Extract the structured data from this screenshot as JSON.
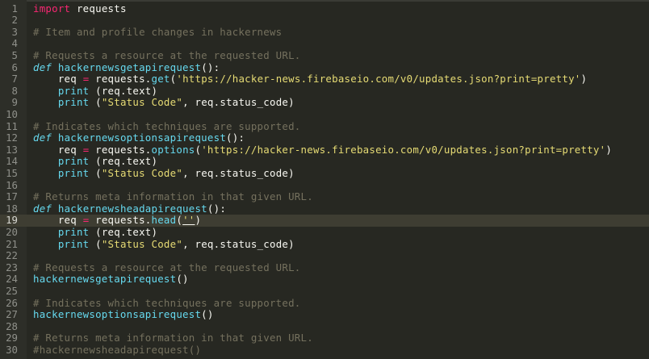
{
  "editor": {
    "colors": {
      "background": "#272822",
      "keyword": "#f92672",
      "function": "#66d9ef",
      "comment": "#75715e",
      "string": "#e6db74",
      "text": "#f8f8f2"
    },
    "current_line": 19,
    "lines": [
      {
        "n": "1",
        "tokens": [
          {
            "t": "import",
            "c": "kw"
          },
          {
            "t": " requests"
          }
        ]
      },
      {
        "n": "2",
        "tokens": []
      },
      {
        "n": "3",
        "tokens": [
          {
            "t": "# Item and profile changes in hackernews",
            "c": "cm"
          }
        ]
      },
      {
        "n": "4",
        "tokens": []
      },
      {
        "n": "5",
        "tokens": [
          {
            "t": "# Requests a resource at the requested URL.",
            "c": "cm"
          }
        ]
      },
      {
        "n": "6",
        "tokens": [
          {
            "t": "def",
            "c": "def"
          },
          {
            "t": " "
          },
          {
            "t": "hackernewsgetapirequest",
            "c": "fn"
          },
          {
            "t": "():"
          }
        ]
      },
      {
        "n": "7",
        "tokens": [
          {
            "t": "    req "
          },
          {
            "t": "=",
            "c": "op"
          },
          {
            "t": " requests."
          },
          {
            "t": "get",
            "c": "bl"
          },
          {
            "t": "("
          },
          {
            "t": "'https://hacker-news.firebaseio.com/v0/updates.json?print=pretty'",
            "c": "str"
          },
          {
            "t": ")"
          }
        ]
      },
      {
        "n": "8",
        "tokens": [
          {
            "t": "    "
          },
          {
            "t": "print",
            "c": "bl"
          },
          {
            "t": " (req.text)"
          }
        ]
      },
      {
        "n": "9",
        "tokens": [
          {
            "t": "    "
          },
          {
            "t": "print",
            "c": "bl"
          },
          {
            "t": " ("
          },
          {
            "t": "\"Status Code\"",
            "c": "str"
          },
          {
            "t": ", req.status_code)"
          }
        ]
      },
      {
        "n": "10",
        "tokens": []
      },
      {
        "n": "11",
        "tokens": [
          {
            "t": "# Indicates which techniques are supported.",
            "c": "cm"
          }
        ]
      },
      {
        "n": "12",
        "tokens": [
          {
            "t": "def",
            "c": "def"
          },
          {
            "t": " "
          },
          {
            "t": "hackernewsoptionsapirequest",
            "c": "fn"
          },
          {
            "t": "():"
          }
        ]
      },
      {
        "n": "13",
        "tokens": [
          {
            "t": "    req "
          },
          {
            "t": "=",
            "c": "op"
          },
          {
            "t": " requests."
          },
          {
            "t": "options",
            "c": "bl"
          },
          {
            "t": "("
          },
          {
            "t": "'https://hacker-news.firebaseio.com/v0/updates.json?print=pretty'",
            "c": "str"
          },
          {
            "t": ")"
          }
        ]
      },
      {
        "n": "14",
        "tokens": [
          {
            "t": "    "
          },
          {
            "t": "print",
            "c": "bl"
          },
          {
            "t": " (req.text)"
          }
        ]
      },
      {
        "n": "15",
        "tokens": [
          {
            "t": "    "
          },
          {
            "t": "print",
            "c": "bl"
          },
          {
            "t": " ("
          },
          {
            "t": "\"Status Code\"",
            "c": "str"
          },
          {
            "t": ", req.status_code)"
          }
        ]
      },
      {
        "n": "16",
        "tokens": []
      },
      {
        "n": "17",
        "tokens": [
          {
            "t": "# Returns meta information in that given URL.",
            "c": "cm"
          }
        ]
      },
      {
        "n": "18",
        "tokens": [
          {
            "t": "def",
            "c": "def"
          },
          {
            "t": " "
          },
          {
            "t": "hackernewsheadapirequest",
            "c": "fn"
          },
          {
            "t": "():"
          }
        ]
      },
      {
        "n": "19",
        "tokens": [
          {
            "t": "    req "
          },
          {
            "t": "=",
            "c": "op"
          },
          {
            "t": " requests."
          },
          {
            "t": "head",
            "c": "bl"
          },
          {
            "t": "("
          },
          {
            "t": "''",
            "c": "str cursor-quote"
          },
          {
            "t": ")"
          }
        ]
      },
      {
        "n": "20",
        "tokens": [
          {
            "t": "    "
          },
          {
            "t": "print",
            "c": "bl"
          },
          {
            "t": " (req.text)"
          }
        ]
      },
      {
        "n": "21",
        "tokens": [
          {
            "t": "    "
          },
          {
            "t": "print",
            "c": "bl"
          },
          {
            "t": " ("
          },
          {
            "t": "\"Status Code\"",
            "c": "str"
          },
          {
            "t": ", req.status_code)"
          }
        ]
      },
      {
        "n": "22",
        "tokens": []
      },
      {
        "n": "23",
        "tokens": [
          {
            "t": "# Requests a resource at the requested URL.",
            "c": "cm"
          }
        ]
      },
      {
        "n": "24",
        "tokens": [
          {
            "t": "hackernewsgetapirequest",
            "c": "fn"
          },
          {
            "t": "()"
          }
        ]
      },
      {
        "n": "25",
        "tokens": []
      },
      {
        "n": "26",
        "tokens": [
          {
            "t": "# Indicates which techniques are supported.",
            "c": "cm"
          }
        ]
      },
      {
        "n": "27",
        "tokens": [
          {
            "t": "hackernewsoptionsapirequest",
            "c": "fn"
          },
          {
            "t": "()"
          }
        ]
      },
      {
        "n": "28",
        "tokens": []
      },
      {
        "n": "29",
        "tokens": [
          {
            "t": "# Returns meta information in that given URL.",
            "c": "cm"
          }
        ]
      },
      {
        "n": "30",
        "tokens": [
          {
            "t": "#hackernewsheadapirequest()",
            "c": "cm"
          }
        ]
      }
    ]
  }
}
